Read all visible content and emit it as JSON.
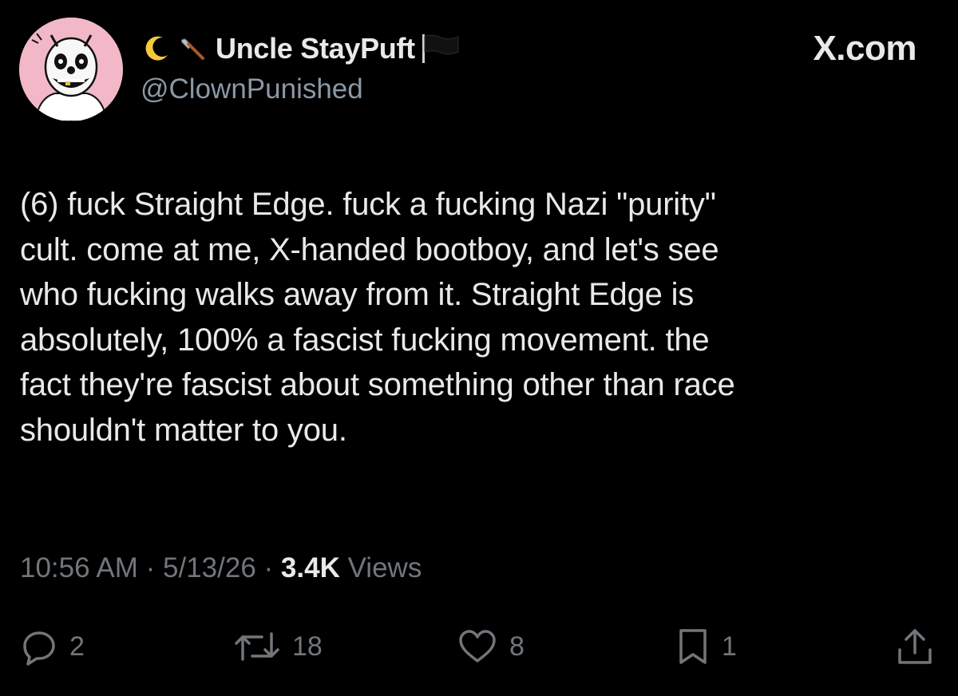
{
  "author": {
    "name": "Uncle StayPuft",
    "handle": "@ClownPunished",
    "avatar_icon": "clown-avatar-icon",
    "name_emojis": [
      "crescent-moon-icon",
      "axe-icon"
    ],
    "name_suffix_icon": "black-flag-icon"
  },
  "brand": "X.com",
  "post": {
    "text": "(6) fuck Straight Edge. fuck a fucking Nazi \"purity\"\ncult. come at me, X-handed bootboy, and let's see\nwho fucking walks away from it. Straight Edge is\nabsolutely, 100% a fascist fucking movement. the\nfact they're fascist about something other than race\nshouldn't matter to you.",
    "time": "10:56 AM",
    "sep": "·",
    "date": "5/13/26",
    "views_count": "3.4K",
    "views_label": "Views"
  },
  "actions": {
    "replies": "2",
    "reposts": "18",
    "likes": "8",
    "bookmarks": "1"
  },
  "colors": {
    "background": "#000000",
    "text": "#e7e9ea",
    "secondary": "#71767b",
    "handle": "#8b98a5",
    "avatar_bg": "#f2b8c8"
  }
}
